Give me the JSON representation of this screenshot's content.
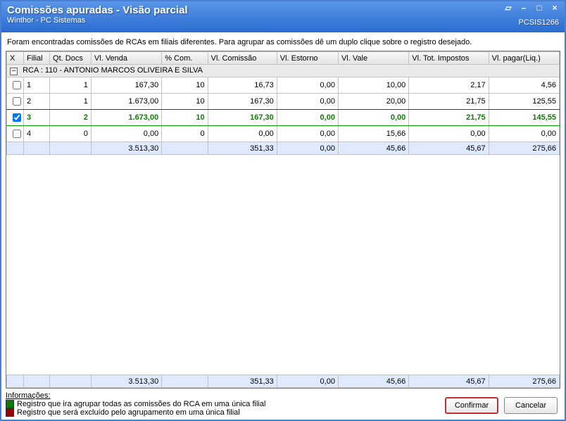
{
  "window": {
    "title": "Comissões apuradas - Visão parcial",
    "subtitle": "Winthor - PC Sistemas",
    "code": "PCSIS1266"
  },
  "instruction": "Foram encontradas comissões de RCAs em filiais diferentes. Para agrupar as comissões dê um duplo clique sobre o registro desejado.",
  "columns": {
    "x": "X",
    "filial": "Filial",
    "qtdocs": "Qt. Docs",
    "vlvenda": "Vl. Venda",
    "pctcom": "% Com.",
    "vlcomissao": "Vl. Comissão",
    "vlestorno": "Vl. Estorno",
    "vlvale": "Vl. Vale",
    "vltotimp": "Vl. Tot. Impostos",
    "vlpagar": "Vl. pagar(Liq.)"
  },
  "group_label": "RCA : 110 - ANTONIO MARCOS OLIVEIRA E SILVA",
  "rows": [
    {
      "checked": false,
      "filial": "1",
      "qt": "1",
      "vv": "167,30",
      "pc": "10",
      "vc": "16,73",
      "ve": "0,00",
      "vl": "10,00",
      "vt": "2,17",
      "vp": "4,56",
      "cls": ""
    },
    {
      "checked": false,
      "filial": "2",
      "qt": "1",
      "vv": "1.673,00",
      "pc": "10",
      "vc": "167,30",
      "ve": "0,00",
      "vl": "20,00",
      "vt": "21,75",
      "vp": "125,55",
      "cls": "red-row"
    },
    {
      "checked": true,
      "filial": "3",
      "qt": "2",
      "vv": "1.673,00",
      "pc": "10",
      "vc": "167,30",
      "ve": "0,00",
      "vl": "0,00",
      "vt": "21,75",
      "vp": "145,55",
      "cls": "green-row"
    },
    {
      "checked": false,
      "filial": "4",
      "qt": "0",
      "vv": "0,00",
      "pc": "0",
      "vc": "0,00",
      "ve": "0,00",
      "vl": "15,66",
      "vt": "0,00",
      "vp": "0,00",
      "cls": ""
    }
  ],
  "subtotal": {
    "vv": "3.513,30",
    "vc": "351,33",
    "ve": "0,00",
    "vl": "45,66",
    "vt": "45,67",
    "vp": "275,66"
  },
  "grandtotal": {
    "vv": "3.513,30",
    "vc": "351,33",
    "ve": "0,00",
    "vl": "45,66",
    "vt": "45,67",
    "vp": "275,66"
  },
  "info": {
    "title": "Informações:",
    "legend_green": "Registro que ira agrupar todas as comissões do RCA em uma única filial",
    "legend_red": "Registro que será excluído pelo agrupamento em uma única filial"
  },
  "buttons": {
    "confirm": "Confirmar",
    "cancel": "Cancelar"
  },
  "colors": {
    "green": "#0a7d00",
    "red": "#9b0000"
  }
}
